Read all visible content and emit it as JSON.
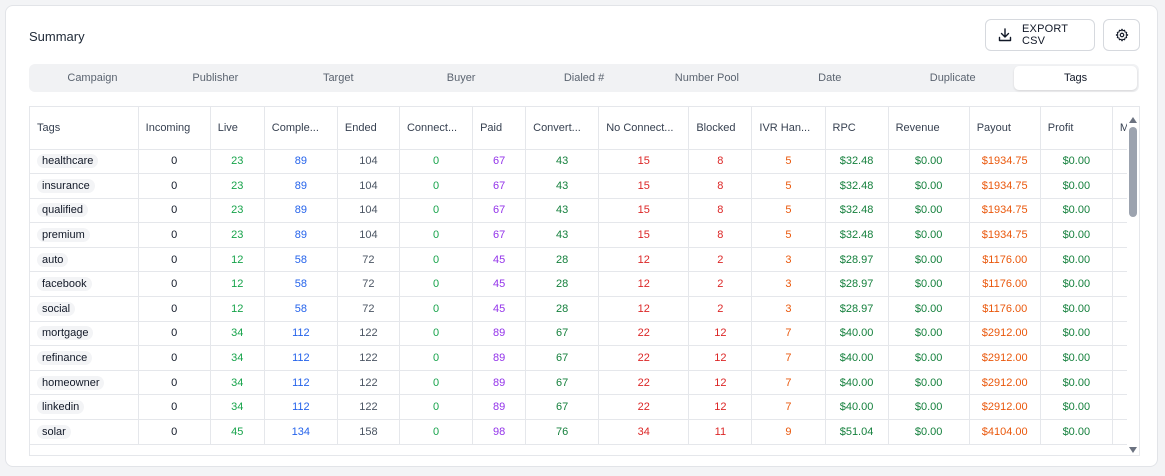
{
  "summary": {
    "title": "Summary",
    "export_label": "EXPORT CSV"
  },
  "tabs": [
    {
      "label": "Campaign"
    },
    {
      "label": "Publisher"
    },
    {
      "label": "Target"
    },
    {
      "label": "Buyer"
    },
    {
      "label": "Dialed #"
    },
    {
      "label": "Number Pool"
    },
    {
      "label": "Date"
    },
    {
      "label": "Duplicate"
    },
    {
      "label": "Tags",
      "active": true
    }
  ],
  "table": {
    "columns": [
      "Tags",
      "Incoming",
      "Live",
      "Comple...",
      "Ended",
      "Connect...",
      "Paid",
      "Convert...",
      "No Connect...",
      "Blocked",
      "IVR Han...",
      "RPC",
      "Revenue",
      "Payout",
      "Profit",
      "M"
    ],
    "rows": [
      [
        "healthcare",
        "0",
        "23",
        "89",
        "104",
        "0",
        "67",
        "43",
        "15",
        "8",
        "5",
        "$32.48",
        "$0.00",
        "$1934.75",
        "$0.00",
        ""
      ],
      [
        "insurance",
        "0",
        "23",
        "89",
        "104",
        "0",
        "67",
        "43",
        "15",
        "8",
        "5",
        "$32.48",
        "$0.00",
        "$1934.75",
        "$0.00",
        ""
      ],
      [
        "qualified",
        "0",
        "23",
        "89",
        "104",
        "0",
        "67",
        "43",
        "15",
        "8",
        "5",
        "$32.48",
        "$0.00",
        "$1934.75",
        "$0.00",
        ""
      ],
      [
        "premium",
        "0",
        "23",
        "89",
        "104",
        "0",
        "67",
        "43",
        "15",
        "8",
        "5",
        "$32.48",
        "$0.00",
        "$1934.75",
        "$0.00",
        ""
      ],
      [
        "auto",
        "0",
        "12",
        "58",
        "72",
        "0",
        "45",
        "28",
        "12",
        "2",
        "3",
        "$28.97",
        "$0.00",
        "$1176.00",
        "$0.00",
        ""
      ],
      [
        "facebook",
        "0",
        "12",
        "58",
        "72",
        "0",
        "45",
        "28",
        "12",
        "2",
        "3",
        "$28.97",
        "$0.00",
        "$1176.00",
        "$0.00",
        ""
      ],
      [
        "social",
        "0",
        "12",
        "58",
        "72",
        "0",
        "45",
        "28",
        "12",
        "2",
        "3",
        "$28.97",
        "$0.00",
        "$1176.00",
        "$0.00",
        ""
      ],
      [
        "mortgage",
        "0",
        "34",
        "112",
        "122",
        "0",
        "89",
        "67",
        "22",
        "12",
        "7",
        "$40.00",
        "$0.00",
        "$2912.00",
        "$0.00",
        ""
      ],
      [
        "refinance",
        "0",
        "34",
        "112",
        "122",
        "0",
        "89",
        "67",
        "22",
        "12",
        "7",
        "$40.00",
        "$0.00",
        "$2912.00",
        "$0.00",
        ""
      ],
      [
        "homeowner",
        "0",
        "34",
        "112",
        "122",
        "0",
        "89",
        "67",
        "22",
        "12",
        "7",
        "$40.00",
        "$0.00",
        "$2912.00",
        "$0.00",
        ""
      ],
      [
        "linkedin",
        "0",
        "34",
        "112",
        "122",
        "0",
        "89",
        "67",
        "22",
        "12",
        "7",
        "$40.00",
        "$0.00",
        "$2912.00",
        "$0.00",
        ""
      ],
      [
        "solar",
        "0",
        "45",
        "134",
        "158",
        "0",
        "98",
        "76",
        "34",
        "11",
        "9",
        "$51.04",
        "$0.00",
        "$4104.00",
        "$0.00",
        ""
      ]
    ]
  },
  "colors": {
    "live": "#16a34a",
    "completed": "#2563eb",
    "paid": "#9333ea",
    "no_connect": "#dc2626",
    "ivr": "#ea580c",
    "payout": "#ea580c"
  }
}
